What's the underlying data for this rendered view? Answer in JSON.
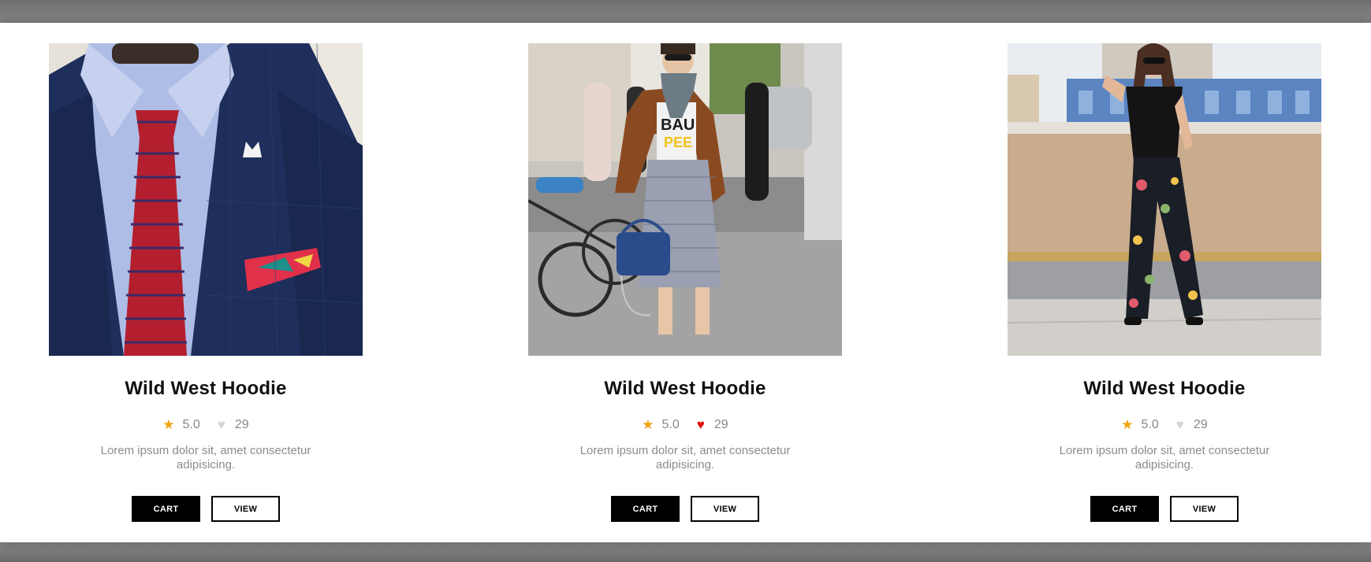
{
  "products": [
    {
      "title": "Wild West Hoodie",
      "rating": "5.0",
      "likes": "29",
      "liked": false,
      "description": "Lorem ipsum dolor sit, amet consectetur adipisicing.",
      "cart_label": "CART",
      "view_label": "VIEW",
      "image": "man-suit-tie-photo"
    },
    {
      "title": "Wild West Hoodie",
      "rating": "5.0",
      "likes": "29",
      "liked": true,
      "description": "Lorem ipsum dolor sit, amet consectetur adipisicing.",
      "cart_label": "CART",
      "view_label": "VIEW",
      "image": "woman-street-style-photo"
    },
    {
      "title": "Wild West Hoodie",
      "rating": "5.0",
      "likes": "29",
      "liked": false,
      "description": "Lorem ipsum dolor sit, amet consectetur adipisicing.",
      "cart_label": "CART",
      "view_label": "VIEW",
      "image": "woman-floral-pants-photo"
    }
  ],
  "icons": {
    "rating": "star-icon",
    "likes": "heart-icon"
  },
  "colors": {
    "star": "#f2a20c",
    "heart_liked": "#e60d0d",
    "heart_default": "#d4d4d4",
    "button_dark": "#000000"
  }
}
